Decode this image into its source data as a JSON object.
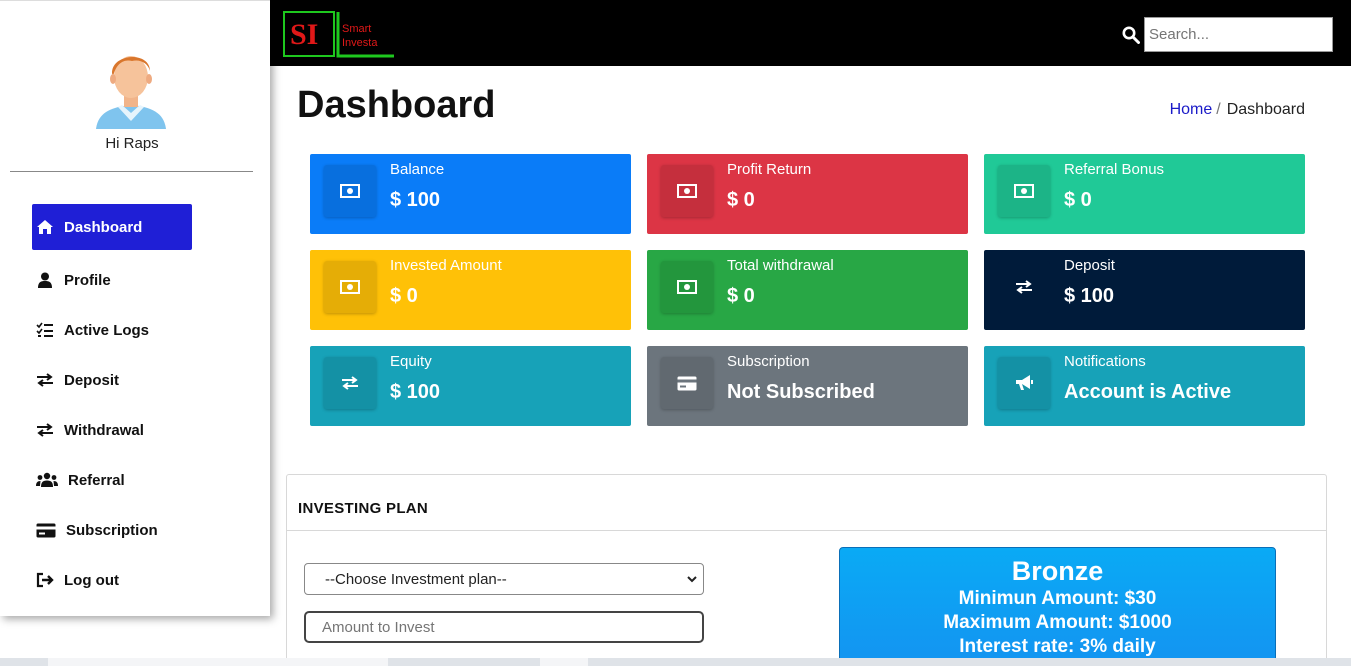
{
  "app": {
    "logo_text_1": "Smart",
    "logo_text_2": "Investa",
    "logo_mark": "SI"
  },
  "sidebar": {
    "greeting": "Hi Raps",
    "items": [
      {
        "label": "Dashboard",
        "icon": "home-icon",
        "active": true
      },
      {
        "label": "Profile",
        "icon": "user-icon",
        "active": false
      },
      {
        "label": "Active Logs",
        "icon": "tasks-icon",
        "active": false
      },
      {
        "label": "Deposit",
        "icon": "exchange-icon",
        "active": false
      },
      {
        "label": "Withdrawal",
        "icon": "exchange-icon",
        "active": false
      },
      {
        "label": "Referral",
        "icon": "users-icon",
        "active": false
      },
      {
        "label": "Subscription",
        "icon": "credit-card-icon",
        "active": false
      },
      {
        "label": "Log out",
        "icon": "sign-out-icon",
        "active": false
      }
    ]
  },
  "topbar": {
    "search_placeholder": "Search..."
  },
  "header": {
    "title": "Dashboard",
    "breadcrumb": [
      "Home",
      "Dashboard"
    ]
  },
  "cards": [
    {
      "label": "Balance",
      "value": "$ 100",
      "color": "#0a7cf8",
      "icon": "money-icon"
    },
    {
      "label": "Profit Return",
      "value": "$ 0",
      "color": "#dc3545",
      "icon": "money-icon"
    },
    {
      "label": "Referral Bonus",
      "value": "$ 0",
      "color": "#20c997",
      "icon": "money-icon"
    },
    {
      "label": "Invested Amount",
      "value": "$ 0",
      "color": "#ffc107",
      "icon": "money-icon"
    },
    {
      "label": "Total withdrawal",
      "value": "$ 0",
      "color": "#28a745",
      "icon": "money-icon"
    },
    {
      "label": "Deposit",
      "value": "$ 100",
      "color": "#001b3a",
      "icon": "exchange-icon"
    },
    {
      "label": "Equity",
      "value": "$ 100",
      "color": "#17a2b8",
      "icon": "exchange-icon"
    },
    {
      "label": "Subscription",
      "value": "Not Subscribed",
      "color": "#6c757d",
      "icon": "credit-card-icon"
    },
    {
      "label": "Notifications",
      "value": "Account is Active",
      "color": "#17a2b8",
      "icon": "bullhorn-icon"
    }
  ],
  "investing_plan": {
    "title": "INVESTING PLAN",
    "select_value": "--Choose Investment plan--",
    "amount_placeholder": "Amount to Invest",
    "plan": {
      "name": "Bronze",
      "min": "Minimun Amount: $30",
      "max": "Maximum Amount: $1000",
      "rate": "Interest rate: 3% daily"
    }
  }
}
